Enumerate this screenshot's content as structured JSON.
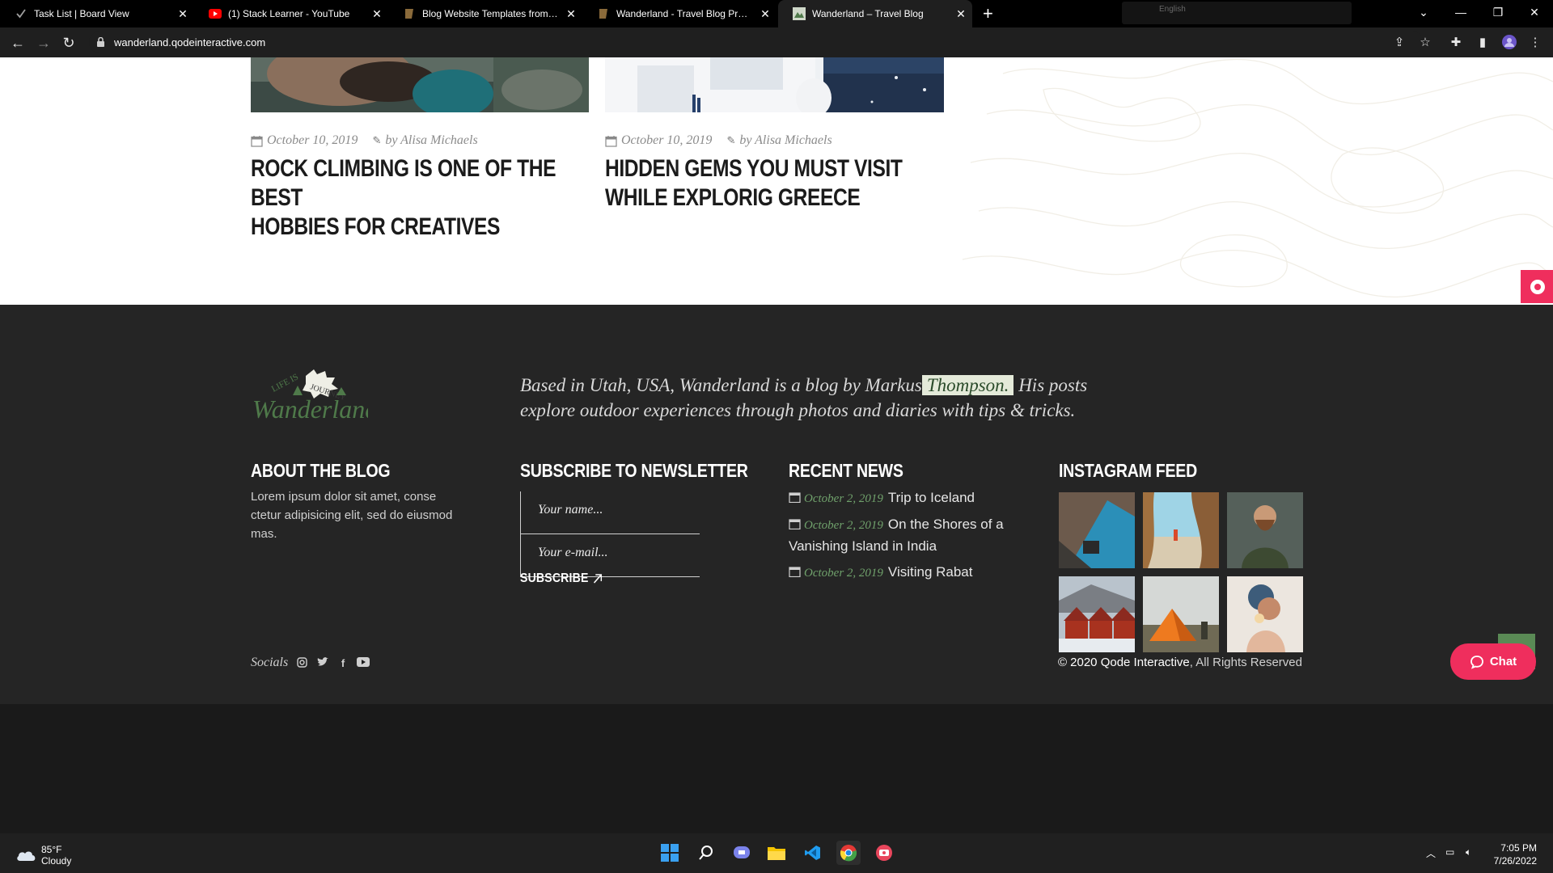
{
  "browser": {
    "tabs": [
      {
        "title": "Task List | Board View",
        "active": false
      },
      {
        "title": "(1) Stack Learner - YouTube",
        "active": false
      },
      {
        "title": "Blog Website Templates from ThemeForest",
        "active": false
      },
      {
        "title": "Wanderland - Travel Blog Preview",
        "active": false
      },
      {
        "title": "Wanderland – Travel Blog",
        "active": true
      }
    ],
    "extension_lang": "English",
    "url": "wanderland.qodeinteractive.com"
  },
  "posts": [
    {
      "date": "October 10, 2019",
      "author": "by Alisa Michaels",
      "title_line1": "ROCK CLIMBING IS ONE OF THE BEST",
      "title_line2": "HOBBIES FOR CREATIVES"
    },
    {
      "date": "October 10, 2019",
      "author": "by Alisa Michaels",
      "title_line1": "HIDDEN GEMS YOU MUST VISIT",
      "title_line2": "WHILE EXPLORIG GREECE"
    }
  ],
  "footer": {
    "intro_before": "Based in Utah, USA, Wanderland is a blog by Markus",
    "intro_highlight": "Thompson.",
    "intro_after": " His posts explore outdoor experiences through photos and diaries with tips & tricks.",
    "about": {
      "title": "ABOUT THE BLOG",
      "text": "Lorem ipsum dolor sit amet, conse ctetur adipisicing elit, sed do eiusmod mas."
    },
    "newsletter": {
      "title": "SUBSCRIBE TO NEWSLETTER",
      "name_placeholder": "Your name...",
      "email_placeholder": "Your e-mail...",
      "button": "SUBSCRIBE"
    },
    "recent_news": {
      "title": "RECENT NEWS",
      "items": [
        {
          "date": "October 2, 2019",
          "text": "Trip to Iceland"
        },
        {
          "date": "October 2, 2019",
          "text": "On the Shores of a Vanishing Island in India"
        },
        {
          "date": "October 2, 2019",
          "text": "Visiting Rabat"
        }
      ]
    },
    "instagram": {
      "title": "INSTAGRAM FEED"
    },
    "socials_label": "Socials",
    "copyright_brand": "© 2020 Qode Interactive",
    "copyright_rest": ", All Rights Reserved"
  },
  "chat": {
    "label": "Chat"
  },
  "taskbar": {
    "temp": "85°F",
    "condition": "Cloudy",
    "time": "7:05 PM",
    "date": "7/26/2022"
  },
  "colors": {
    "accent_pink": "#ef2e5d",
    "footer_bg": "#252525",
    "news_date_green": "#6fa06b",
    "logo_green": "#4f7a4a"
  }
}
